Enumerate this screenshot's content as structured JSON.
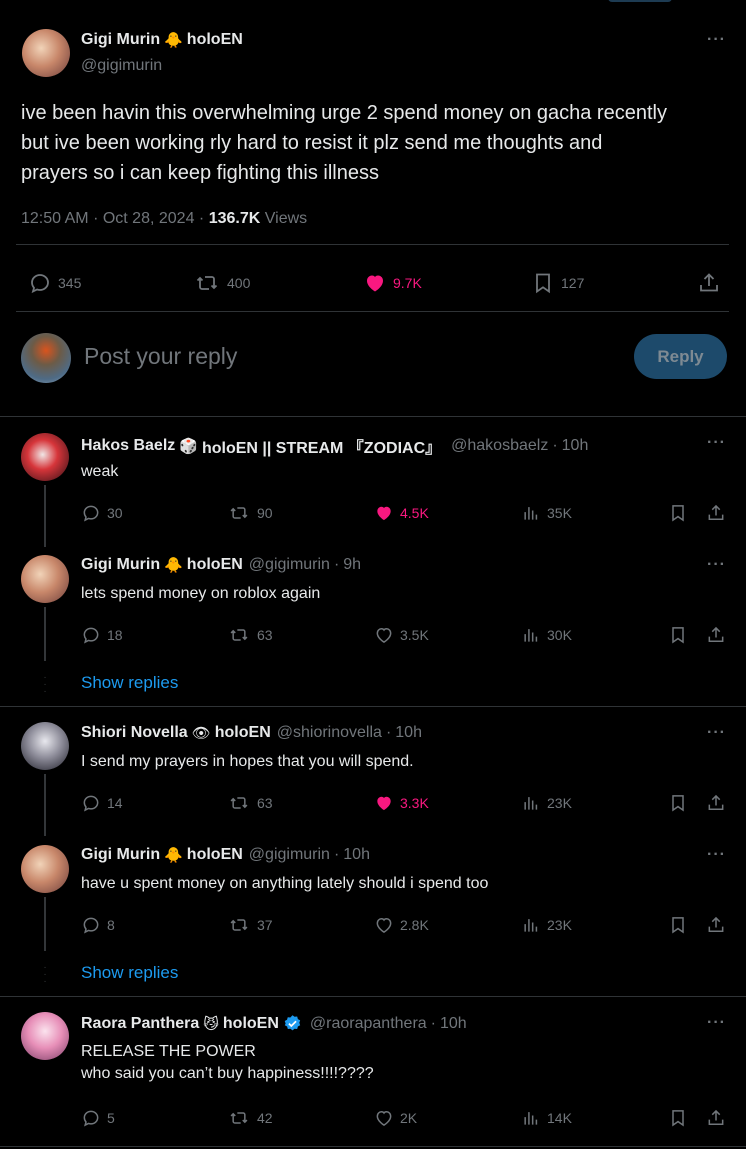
{
  "main_post": {
    "name": "Gigi Murin",
    "name_emoji": "🐥",
    "org": "holoEN",
    "handle": "@gigimurin",
    "text_line1": "ive been havin this overwhelming urge 2 spend money on gacha recently",
    "text_line2": "but ive been working rly hard to resist it plz send me thoughts and",
    "text_line3": "prayers so i can keep fighting this illness",
    "time": "12:50 AM",
    "date": "Oct 28, 2024",
    "views": "136.7K",
    "views_label": "Views",
    "replies": "345",
    "reposts": "400",
    "likes": "9.7K",
    "bookmarks": "127"
  },
  "composer": {
    "placeholder": "Post your reply",
    "button": "Reply"
  },
  "show_replies_label": "Show replies",
  "threads": [
    {
      "name": "Hakos Baelz",
      "emoji": "🎲",
      "org": "holoEN || STREAM 『ZODIAC』",
      "handle": "@hakosbaelz",
      "age": "10h",
      "text": "weak",
      "replies": "30",
      "reposts": "90",
      "likes": "4.5K",
      "views": "35K",
      "liked": true
    },
    {
      "name": "Gigi Murin",
      "emoji": "🐥",
      "org": "holoEN",
      "handle": "@gigimurin",
      "age": "9h",
      "text": "lets spend money on roblox again",
      "replies": "18",
      "reposts": "63",
      "likes": "3.5K",
      "views": "30K",
      "liked": false
    },
    {
      "name": "Shiori Novella",
      "emoji": "👁",
      "org": "holoEN",
      "handle": "@shiorinovella",
      "age": "10h",
      "text": "I send my prayers in hopes that you will spend.",
      "replies": "14",
      "reposts": "63",
      "likes": "3.3K",
      "views": "23K",
      "liked": true
    },
    {
      "name": "Gigi Murin",
      "emoji": "🐥",
      "org": "holoEN",
      "handle": "@gigimurin",
      "age": "10h",
      "text": "have u spent money on anything lately should i spend too",
      "replies": "8",
      "reposts": "37",
      "likes": "2.8K",
      "views": "23K",
      "liked": false
    },
    {
      "name": "Raora Panthera",
      "emoji": "😼",
      "org": "holoEN",
      "handle": "@raorapanthera",
      "age": "10h",
      "text_line1": "RELEASE THE POWER",
      "text_line2": "who said you can’t buy happiness!!!!????",
      "replies": "5",
      "reposts": "42",
      "likes": "2K",
      "views": "14K",
      "liked": false
    }
  ],
  "colors": {
    "background": "#000000",
    "text": "#e7e9ea",
    "muted": "#71767b",
    "like": "#f91880",
    "link": "#1d9bf0",
    "reply_button": "#1d4a6b"
  }
}
